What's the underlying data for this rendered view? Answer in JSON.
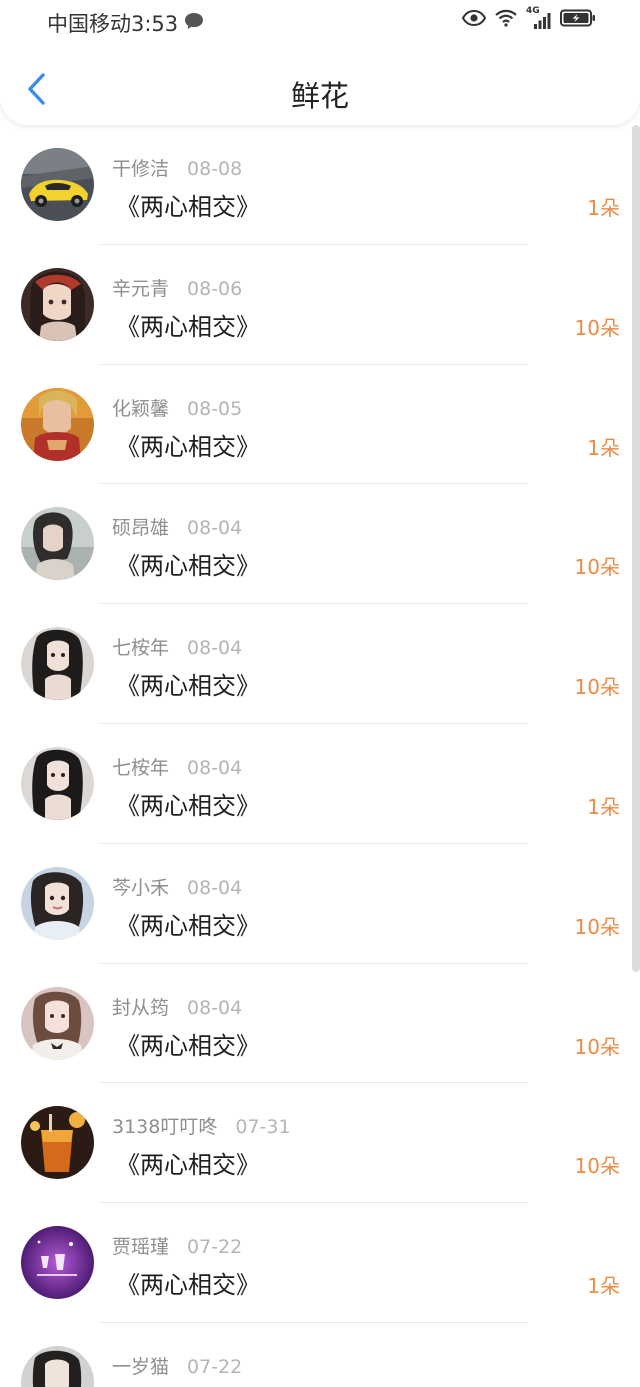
{
  "status_bar": {
    "carrier_time": "中国移动3:53",
    "network": "4G"
  },
  "nav": {
    "title": "鲜花"
  },
  "colors": {
    "accent_blue": "#3a8ee6",
    "count_orange": "#ef8a43"
  },
  "icons": {
    "back": "chevron-left-icon",
    "message": "message-bubble-icon",
    "eye": "eye-icon",
    "wifi": "wifi-icon",
    "signal": "signal-bars-icon",
    "battery": "battery-charging-icon"
  },
  "records": [
    {
      "name": "干修洁",
      "date": "08-08",
      "gift": "《两心相交》",
      "count": "1朵"
    },
    {
      "name": "辛元青",
      "date": "08-06",
      "gift": "《两心相交》",
      "count": "10朵"
    },
    {
      "name": "化颖馨",
      "date": "08-05",
      "gift": "《两心相交》",
      "count": "1朵"
    },
    {
      "name": "硕昂雄",
      "date": "08-04",
      "gift": "《两心相交》",
      "count": "10朵"
    },
    {
      "name": "七桉年",
      "date": "08-04",
      "gift": "《两心相交》",
      "count": "10朵"
    },
    {
      "name": "七桉年",
      "date": "08-04",
      "gift": "《两心相交》",
      "count": "1朵"
    },
    {
      "name": "芩小禾",
      "date": "08-04",
      "gift": "《两心相交》",
      "count": "10朵"
    },
    {
      "name": "封从筠",
      "date": "08-04",
      "gift": "《两心相交》",
      "count": "10朵"
    },
    {
      "name": "3138叮叮咚",
      "date": "07-31",
      "gift": "《两心相交》",
      "count": "10朵"
    },
    {
      "name": "贾瑶瑾",
      "date": "07-22",
      "gift": "《两心相交》",
      "count": "1朵"
    },
    {
      "name": "一岁猫",
      "date": "07-22",
      "gift": "",
      "count": ""
    }
  ]
}
